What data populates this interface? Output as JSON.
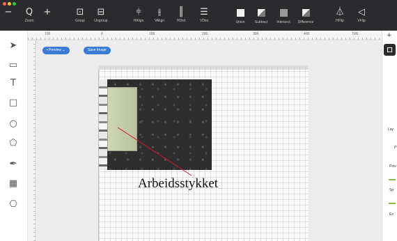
{
  "toolbar": {
    "items": [
      {
        "glyph": "−",
        "label": ""
      },
      {
        "glyph": "Q",
        "label": "Zoom"
      },
      {
        "glyph": "+",
        "label": ""
      },
      {
        "glyph": "⊡",
        "label": "Group"
      },
      {
        "glyph": "⊟",
        "label": "Ungroup"
      },
      {
        "glyph": "⫩",
        "label": "HAlign"
      },
      {
        "glyph": "⫲",
        "label": "VAlign"
      },
      {
        "glyph": "║",
        "label": "HDist"
      },
      {
        "glyph": "☰",
        "label": "VDist"
      },
      {
        "label": "Union"
      },
      {
        "label": "Subtract"
      },
      {
        "label": "Intersect"
      },
      {
        "label": "Difference"
      },
      {
        "glyph": "⏃",
        "label": "HFlip"
      },
      {
        "glyph": "◁",
        "label": "VFlip"
      }
    ]
  },
  "ruler": {
    "ticks": [
      "100",
      "0",
      "100",
      "200",
      "300",
      "400",
      "500"
    ]
  },
  "canvas": {
    "preview_label": "Preview",
    "save_image_label": "Save Image",
    "callout": "Arbeidsstykket"
  },
  "rightpanel": {
    "lay": "Lay",
    "p": "P",
    "pow": "Pow",
    "sp": "Sp",
    "ex": "Ex"
  },
  "colors": {
    "toolbar": "#2b2b2e",
    "accent": "#3a7bd5",
    "callout_line": "#d0142c",
    "slider": "#7ac143"
  }
}
